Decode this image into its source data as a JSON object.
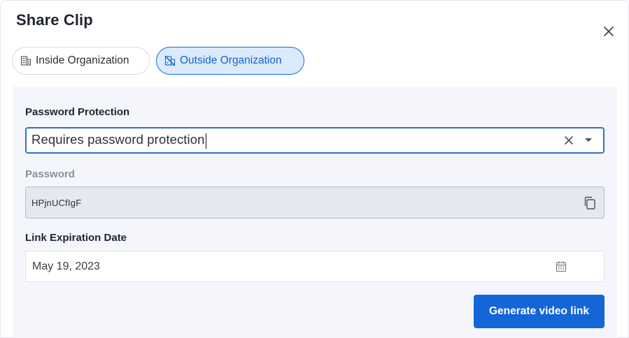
{
  "dialog": {
    "title": "Share Clip",
    "close_icon": "close-icon"
  },
  "tabs": [
    {
      "label": "Inside Organization",
      "icon": "building-icon",
      "active": false
    },
    {
      "label": "Outside Organization",
      "icon": "building-off-icon",
      "active": true
    }
  ],
  "form": {
    "password_protection": {
      "label": "Password Protection",
      "value": "Requires password protection",
      "clear_icon": "clear-icon",
      "dropdown_icon": "chevron-down-icon"
    },
    "password": {
      "label": "Password",
      "value": "HPjnUCfIgF",
      "copy_icon": "copy-icon"
    },
    "link_expiration": {
      "label": "Link Expiration Date",
      "value": "May 19, 2023",
      "calendar_icon": "calendar-icon"
    },
    "generate_label": "Generate video link"
  },
  "colors": {
    "accent": "#1465d8",
    "active_tab_bg": "#dbeafc",
    "panel_bg": "#f4f6fb",
    "focus_border": "#2f72c4"
  }
}
